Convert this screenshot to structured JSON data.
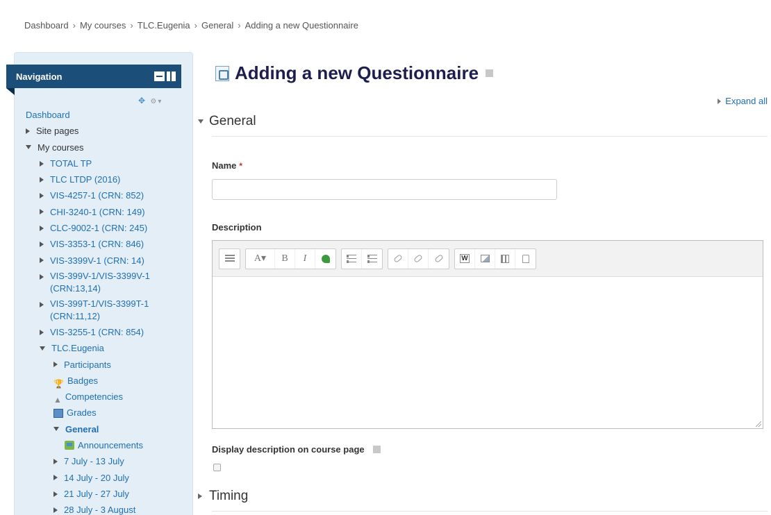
{
  "breadcrumb": [
    "Dashboard",
    "My courses",
    "TLC.Eugenia",
    "General",
    "Adding a new Questionnaire"
  ],
  "breadcrumb_sep": "›",
  "navigation": {
    "title": "Navigation",
    "items": {
      "dashboard": "Dashboard",
      "site_pages": "Site pages",
      "my_courses": "My courses",
      "c1": "TOTAL TP",
      "c2": "TLC LTDP (2016)",
      "c3": "VIS-4257-1 (CRN: 852)",
      "c4": "CHI-3240-1 (CRN: 149)",
      "c5": "CLC-9002-1 (CRN: 245)",
      "c6": "VIS-3353-1 (CRN: 846)",
      "c7": "VIS-3399V-1 (CRN: 14)",
      "c8": "VIS-399V-1/VIS-3399V-1 (CRN:13,14)",
      "c9": "VIS-399T-1/VIS-3399T-1 (CRN:11,12)",
      "c10": "VIS-3255-1 (CRN: 854)",
      "tlc": "TLC.Eugenia",
      "participants": "Participants",
      "badges": "Badges",
      "competencies": "Competencies",
      "grades": "Grades",
      "general": "General",
      "announcements": "Announcements",
      "w1": "7 July - 13 July",
      "w2": "14 July - 20 July",
      "w3": "21 July - 27 July",
      "w4": "28 July - 3 August"
    }
  },
  "page": {
    "title": "Adding a new Questionnaire",
    "expand_all": "Expand all",
    "section_general": "General",
    "section_timing": "Timing",
    "name_label": "Name",
    "required_mark": "*",
    "name_value": "",
    "description_label": "Description",
    "display_description_label": "Display description on course page"
  },
  "editor_toolbar": {
    "bold": "B",
    "italic": "I",
    "font": "A"
  }
}
